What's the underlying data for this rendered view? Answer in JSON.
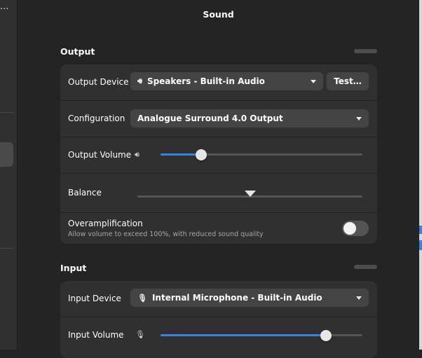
{
  "window": {
    "title": "Sound"
  },
  "sidebar": {
    "menu_icon": "more-dots-icon"
  },
  "output": {
    "section_title": "Output",
    "device": {
      "label": "Output Device",
      "value": "Speakers - Built-in Audio",
      "icon": "speaker-icon",
      "test_label": "Test…"
    },
    "configuration": {
      "label": "Configuration",
      "value": "Analogue Surround 4.0 Output"
    },
    "volume": {
      "label": "Output Volume",
      "icon": "speaker-icon",
      "level": 0.2
    },
    "balance": {
      "label": "Balance",
      "level": 0.5
    },
    "overamplification": {
      "label": "Overamplification",
      "description": "Allow volume to exceed 100%, with reduced sound quality",
      "enabled": false
    }
  },
  "input": {
    "section_title": "Input",
    "device": {
      "label": "Input Device",
      "value": "Internal Microphone - Built-in Audio",
      "icon": "microphone-icon"
    },
    "volume": {
      "label": "Input Volume",
      "icon": "microphone-icon",
      "level": 0.82
    }
  },
  "colors": {
    "accent": "#3584e4",
    "background": "#242424",
    "card": "#303030",
    "control": "#444444"
  }
}
